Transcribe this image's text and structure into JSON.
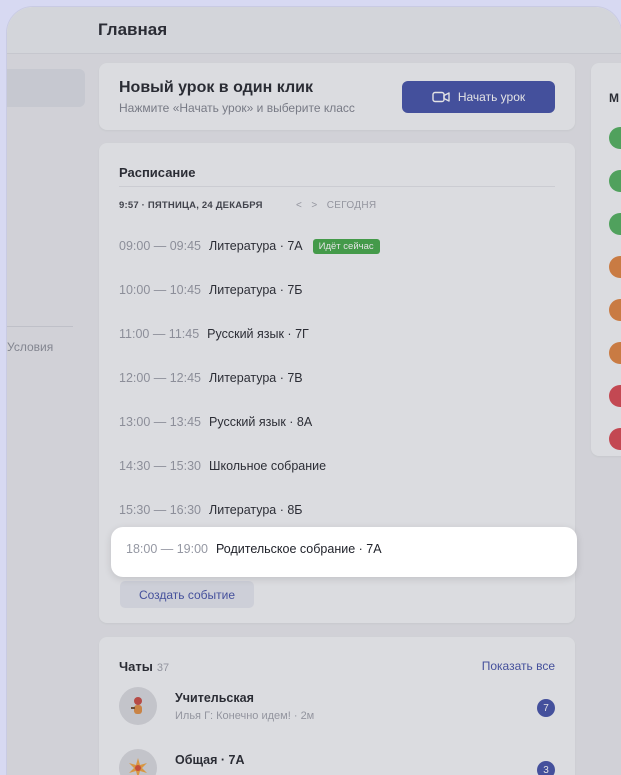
{
  "header": {
    "title": "Главная"
  },
  "sidebar": {
    "terms_label": "Условия"
  },
  "new_lesson": {
    "title": "Новый урок в один клик",
    "subtitle": "Нажмите «Начать урок» и выберите класс",
    "start_button": "Начать урок",
    "camera_icon": "video-camera-icon"
  },
  "schedule": {
    "title": "Расписание",
    "date": "9:57 · ПЯТНИЦА, 24 ДЕКАБРЯ",
    "prev": "<",
    "next": ">",
    "today": "СЕГОДНЯ",
    "items": [
      {
        "time": "09:00 — 09:45",
        "title": "Литература · 7А",
        "badge": "Идёт сейчас"
      },
      {
        "time": "10:00 — 10:45",
        "title": "Литература · 7Б"
      },
      {
        "time": "11:00 — 11:45",
        "title": "Русский язык · 7Г"
      },
      {
        "time": "12:00 — 12:45",
        "title": "Литература · 7В"
      },
      {
        "time": "13:00 — 13:45",
        "title": "Русский язык · 8А"
      },
      {
        "time": "14:30 — 15:30",
        "title": "Школьное собрание"
      },
      {
        "time": "15:30 — 16:30",
        "title": "Литература · 8Б"
      },
      {
        "time": "18:00 — 19:00",
        "title": "Родительское собрание · 7А"
      }
    ],
    "create_button": "Создать событие"
  },
  "chats": {
    "title": "Чаты",
    "count": "37",
    "show_all": "Показать все",
    "items": [
      {
        "name": "Учительская",
        "preview": "Илья Г: Конечно идем!",
        "time": "2м",
        "unread": "7"
      },
      {
        "name": "Общая · 7А",
        "unread": "3"
      }
    ]
  },
  "right_panel": {
    "title_initial": "М",
    "dot_colors": [
      "#4caf5a",
      "#4caf5a",
      "#4caf5a",
      "#e0813a",
      "#e0813a",
      "#e0813a",
      "#d8434c",
      "#d8434c"
    ]
  },
  "colors": {
    "accent": "#3e4ca6",
    "now_badge": "#3ea742"
  }
}
